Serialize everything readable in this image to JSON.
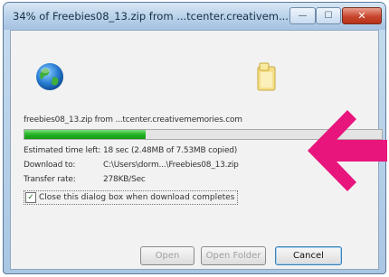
{
  "window": {
    "title": "34% of Freebies08_13.zip from ...tcenter.creativem...",
    "minimize_glyph": "—",
    "maximize_glyph": "☐",
    "close_glyph": "✕"
  },
  "icons": {
    "globe": "globe-icon",
    "folder": "folder-icon",
    "arrow": "arrow-left-icon"
  },
  "download": {
    "file_line": "freebies08_13.zip from ...tcenter.creativememories.com",
    "progress_percent": 34,
    "estimated_label": "Estimated time left:",
    "estimated_value": "18 sec (2.48MB of 7.53MB copied)",
    "download_to_label": "Download to:",
    "download_to_value": "C:\\Users\\dorm...\\Freebies08_13.zip",
    "transfer_rate_label": "Transfer rate:",
    "transfer_rate_value": "278KB/Sec",
    "close_checkbox_label": "Close this dialog box when download completes",
    "close_checkbox_checked": true
  },
  "buttons": {
    "open": "Open",
    "open_folder": "Open Folder",
    "cancel": "Cancel"
  },
  "colors": {
    "arrow": "#e8157c",
    "progress": "#22b022"
  }
}
